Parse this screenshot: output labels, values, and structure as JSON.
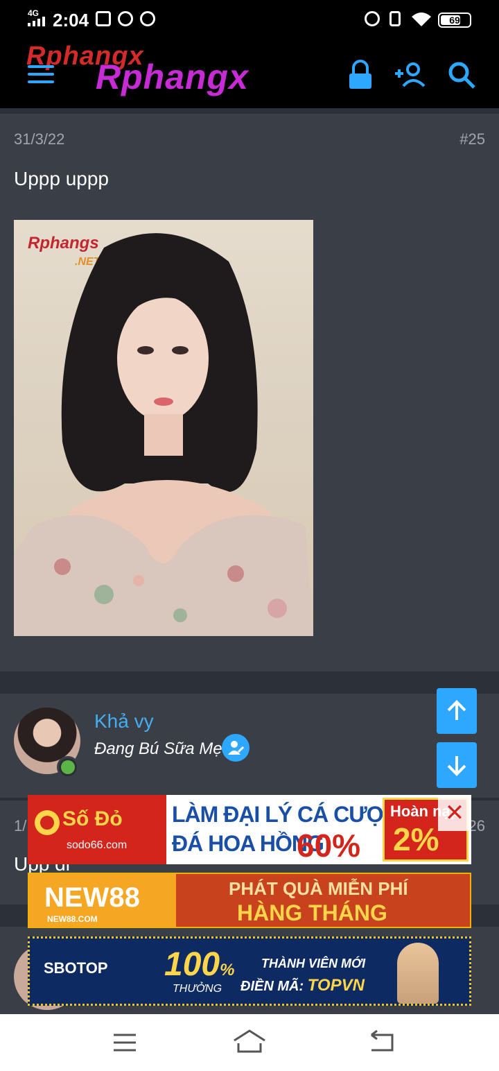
{
  "status_bar": {
    "network": "4G",
    "time": "2:04",
    "battery": "69"
  },
  "header": {
    "logo_text": "Rphangx",
    "icons": [
      "menu-icon",
      "lock-icon",
      "add-user-icon",
      "search-icon"
    ]
  },
  "post": {
    "date": "31/3/22",
    "number": "#25",
    "text": "Uppp uppp",
    "image_watermark": "Rphangs",
    "image_watermark_sub": ".NET"
  },
  "next_post": {
    "author": "Khả vy",
    "author_title": "Đang Bú Sữa Mẹ",
    "date": "1/",
    "number": "26",
    "text": "Upp đi"
  },
  "ads": {
    "ad1": {
      "brand": "Số Đỏ",
      "domain": "sodo66.com",
      "line1": "LÀM ĐẠI LÝ CÁ CƯỢC BÓNG",
      "line2": "ĐÁ HOA HỒNG",
      "percent": "60%",
      "promo_label": "Hoàn nạp",
      "promo_value": "2%"
    },
    "ad2": {
      "brand": "NEW88",
      "domain": "NEW88.COM",
      "line1": "PHÁT QUÀ MIỄN PHÍ",
      "line2": "HÀNG THÁNG"
    },
    "ad3": {
      "brand": "SBOTOP",
      "percent": "100",
      "percent_sign": "%",
      "sub": "THƯỞNG",
      "line1": "THÀNH VIÊN MỚI",
      "line2_prefix": "ĐIỀN MÃ:",
      "code": "TOPVN"
    }
  },
  "colors": {
    "background": "#3a3e47",
    "accent": "#2ea8ff",
    "username": "#44aef0",
    "online": "#5cb346"
  }
}
